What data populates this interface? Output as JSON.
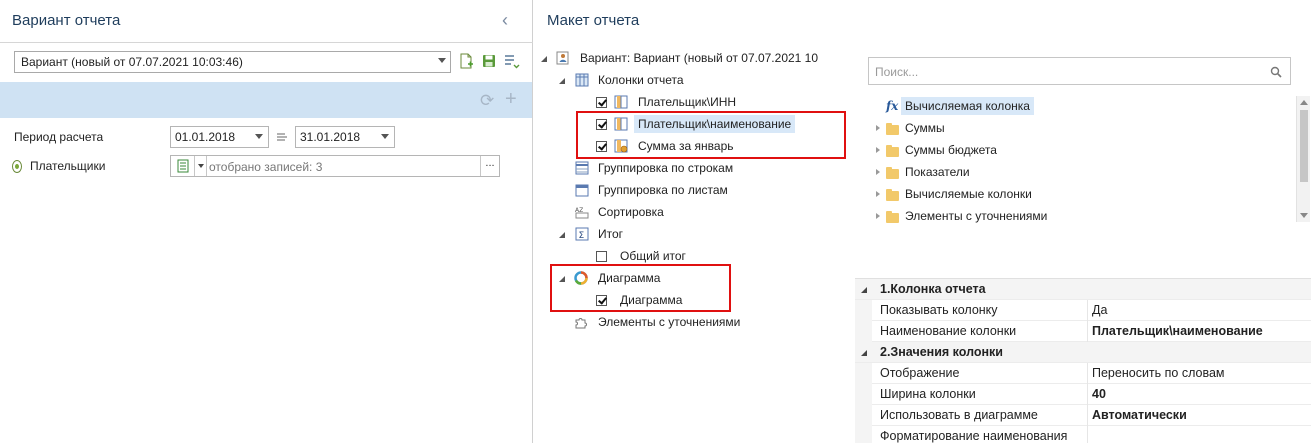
{
  "left": {
    "title": "Вариант отчета",
    "collapse_icon": "chevron-left-icon",
    "variant_value": "Вариант (новый от 07.07.2021 10:03:46)",
    "toolbar_icons": [
      "new-document-icon",
      "save-icon",
      "list-settings-icon"
    ],
    "bar_icons": [
      "history-icon",
      "plus-icon"
    ],
    "period_label": "Период расчета",
    "date_from": "01.01.2018",
    "date_to": "31.01.2018",
    "range_icon": "range-separator-icon",
    "payers_label": "Плательщики",
    "payers_value": "отобрано записей: 3",
    "dots": "..."
  },
  "right": {
    "title": "Макет отчета",
    "tree": {
      "root": "Вариант: Вариант (новый от 07.07.2021 10",
      "columns": "Колонки отчета",
      "col1": "Плательщик\\ИНН",
      "col2": "Плательщик\\наименование",
      "col3": "Сумма за январь",
      "group_rows": "Группировка по строкам",
      "group_sheets": "Группировка по листам",
      "sort": "Сортировка",
      "total": "Итог",
      "total_general": "Общий итог",
      "diagram": "Диаграмма",
      "diagram_child": "Диаграмма",
      "elements": "Элементы с уточнениями"
    },
    "search_placeholder": "Поиск...",
    "search_icon": "search-icon",
    "fields": {
      "calc_column": "Вычисляемая колонка",
      "folders": [
        "Суммы",
        "Суммы бюджета",
        "Показатели",
        "Вычисляемые колонки",
        "Элементы с уточнениями"
      ]
    },
    "props": {
      "cat1": "1.Колонка отчета",
      "show_col_k": "Показывать колонку",
      "show_col_v": "Да",
      "col_name_k": "Наименование колонки",
      "col_name_v": "Плательщик\\наименование",
      "cat2": "2.Значения колонки",
      "display_k": "Отображение",
      "display_v": "Переносить по словам",
      "width_k": "Ширина колонки",
      "width_v": "40",
      "use_diag_k": "Использовать в диаграмме",
      "use_diag_v": "Автоматически",
      "format_k": "Форматирование наименования"
    }
  },
  "colors": {
    "accent_bar": "#cfe2f3",
    "highlight": "#e01010",
    "selected": "#d8e8f8"
  }
}
